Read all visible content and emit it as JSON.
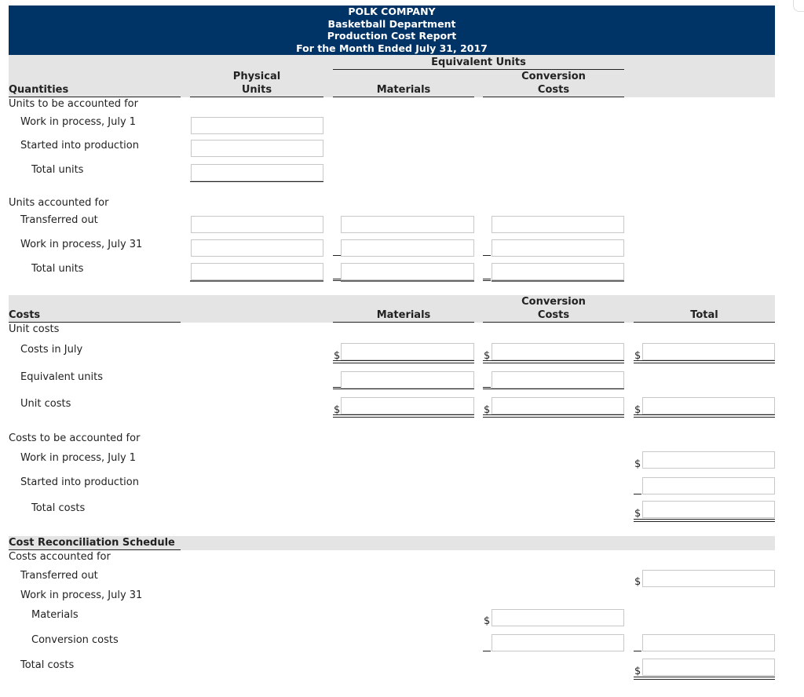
{
  "header": {
    "company": "POLK COMPANY",
    "department": "Basketball Department",
    "report": "Production Cost Report",
    "period": "For the Month Ended July 31, 2017"
  },
  "quantities": {
    "section_title": "Quantities",
    "equivalent_units_label": "Equivalent Units",
    "col_physical_line1": "Physical",
    "col_physical_line2": "Units",
    "col_materials": "Materials",
    "col_conversion_line1": "Conversion",
    "col_conversion_line2": "Costs",
    "units_to_be_accounted_for": "Units to be accounted for",
    "wip_july1": "Work in process, July 1",
    "started": "Started into production",
    "total_units": "Total units",
    "units_accounted_for": "Units accounted for",
    "transferred_out": "Transferred out",
    "wip_july31": "Work in process, July 31",
    "total_units_2": "Total units"
  },
  "costs": {
    "section_title": "Costs",
    "col_materials": "Materials",
    "col_conversion_line1": "Conversion",
    "col_conversion_line2": "Costs",
    "col_total": "Total",
    "unit_costs_heading": "Unit costs",
    "costs_in_july": "Costs in July",
    "equivalent_units": "Equivalent units",
    "unit_costs": "Unit costs",
    "costs_to_be_accounted_for": "Costs to be accounted for",
    "wip_july1": "Work in process, July 1",
    "started": "Started into production",
    "total_costs": "Total costs"
  },
  "reconciliation": {
    "section_title": "Cost Reconciliation Schedule",
    "costs_accounted_for": "Costs accounted for",
    "transferred_out": "Transferred out",
    "wip_july31": "Work in process, July 31",
    "materials": "Materials",
    "conversion_costs": "Conversion costs",
    "total_costs": "Total costs"
  },
  "symbols": {
    "dollar": "$"
  },
  "inputs": {
    "value": ""
  }
}
